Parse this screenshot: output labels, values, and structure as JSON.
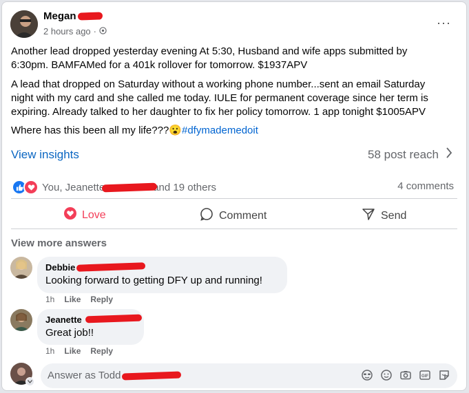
{
  "post": {
    "author_name": "Megan",
    "time": "2 hours ago",
    "privacy_dot": "·",
    "paragraph1": "Another lead dropped yesterday evening At 5:30, Husband and wife apps submitted by 6:30pm.  BAMFAMed for a 401k rollover for tomorrow.  $1937APV",
    "paragraph2": "A lead that dropped on Saturday without a working phone number...sent an email Saturday night with my card and she called me today.  IULE for permanent coverage since her term is expiring. Already talked to her daughter to fix her policy tomorrow. 1 app tonight $1005APV",
    "paragraph3_text": "Where has this been all my life???",
    "emoji": "😮",
    "hashtag": "#dfymademedoit",
    "more_options": "···"
  },
  "insights": {
    "label": "View insights",
    "reach": "58 post reach"
  },
  "reactions": {
    "prefix": "You, Jeanette ",
    "suffix": "and 19 others",
    "comments": "4 comments",
    "like_color": "#1877f2",
    "love_color": "#f33e58"
  },
  "actions": {
    "love": "Love",
    "comment": "Comment",
    "send": "Send"
  },
  "comments_section": {
    "view_more": "View more answers",
    "items": [
      {
        "name": "Debbie",
        "text": "Looking forward to getting DFY up and running!",
        "time": "1h",
        "like": "Like",
        "reply": "Reply"
      },
      {
        "name": "Jeanette",
        "text": "Great job!!",
        "time": "1h",
        "like": "Like",
        "reply": "Reply"
      }
    ]
  },
  "composer": {
    "placeholder": "Answer as Todd",
    "icons": [
      "avatar-sticker-icon",
      "emoji-icon",
      "camera-icon",
      "gif-icon",
      "sticker-icon"
    ]
  },
  "redaction_color": "#e8181e"
}
